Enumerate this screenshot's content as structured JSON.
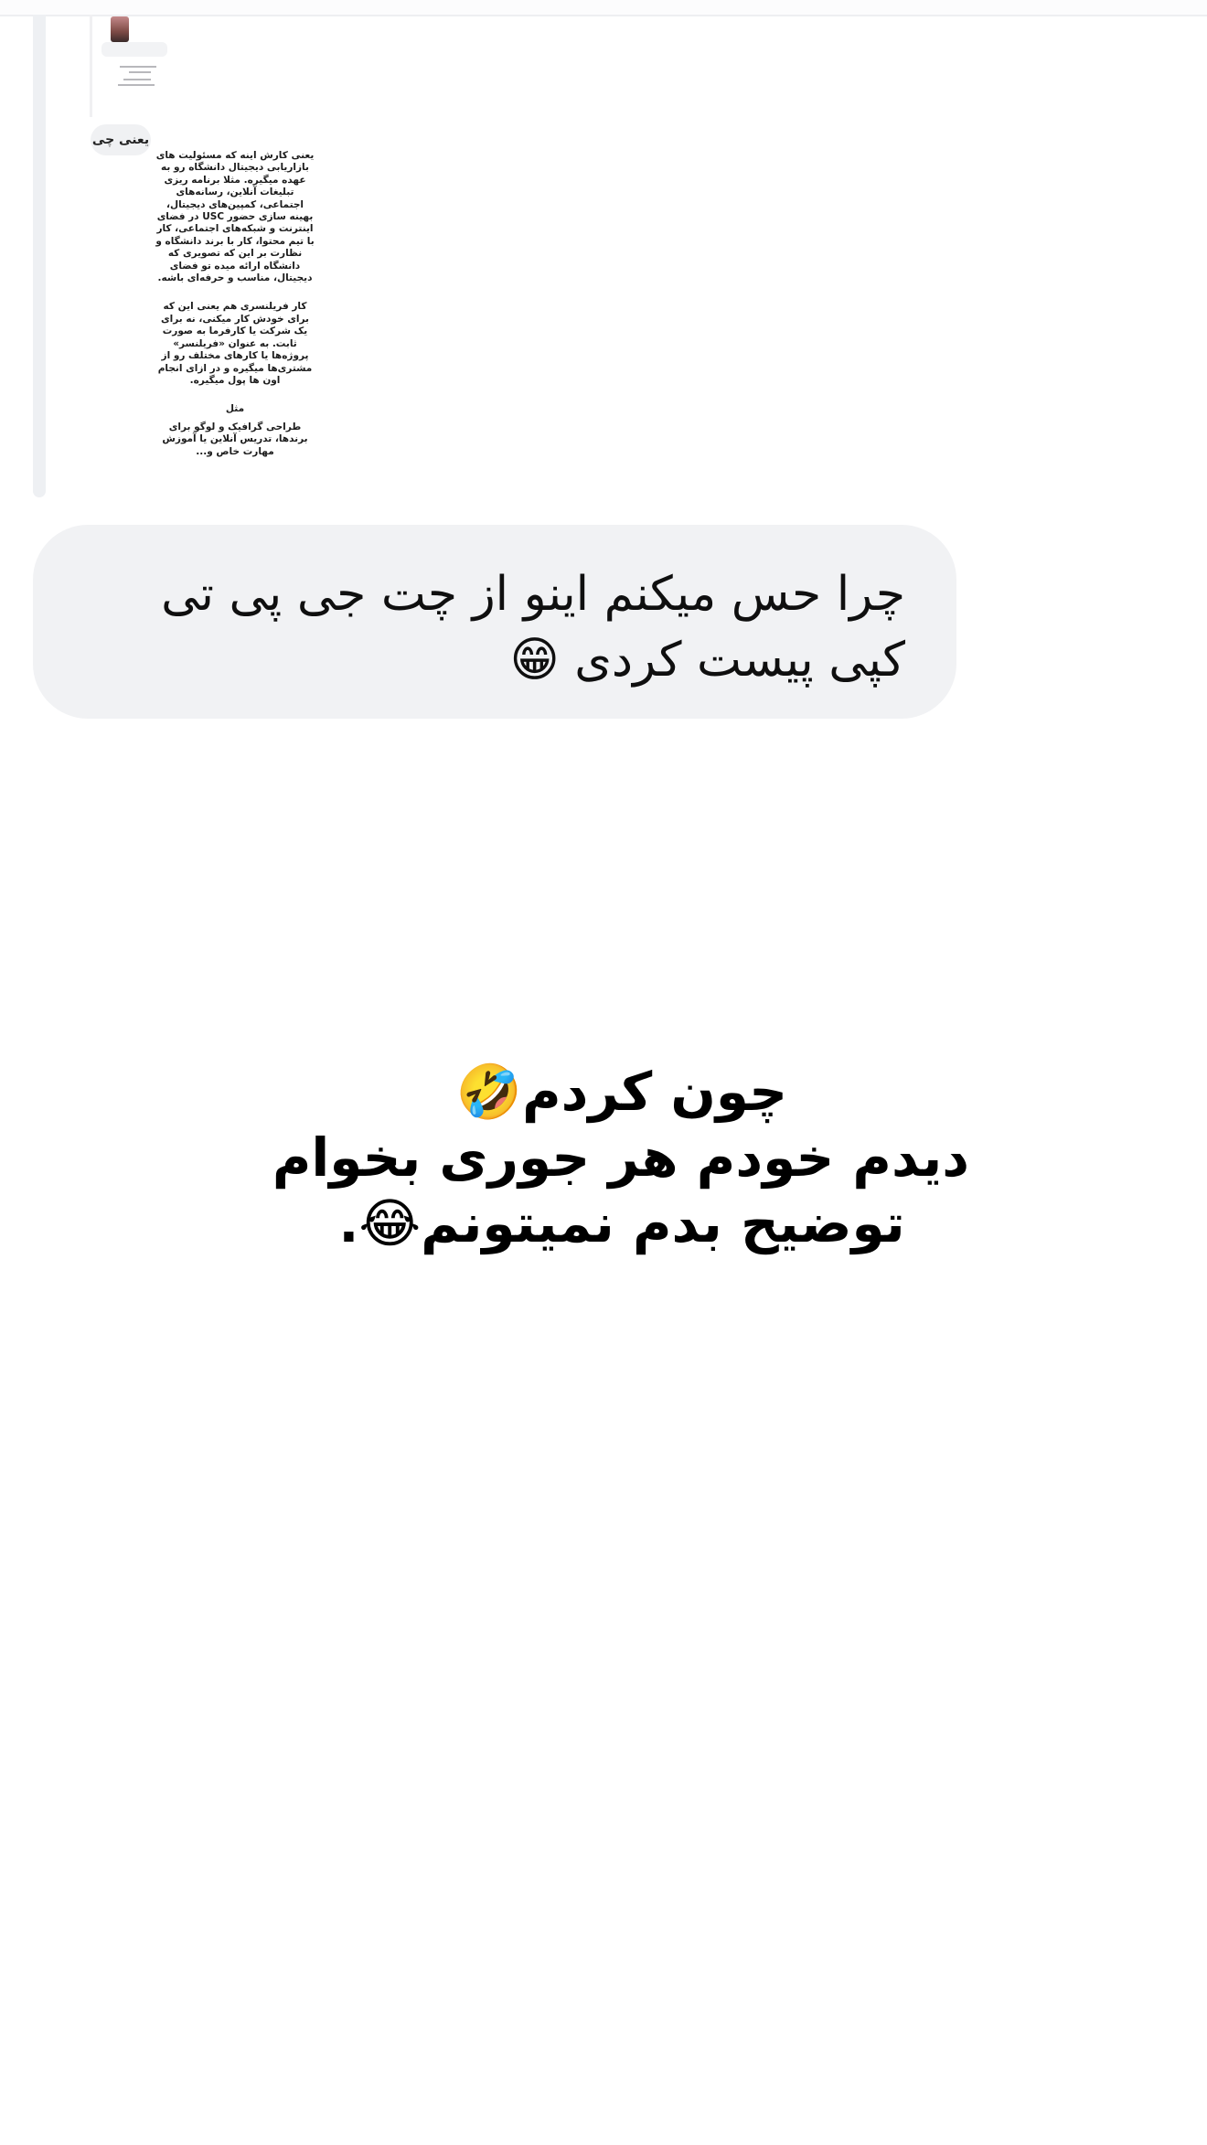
{
  "reply_preview": {
    "thumb_lines": 4
  },
  "small_bubble": {
    "label": "یعنی چی"
  },
  "received_message": {
    "paragraphs": [
      "یعنی کارش اینه که مسئولیت های بازاریابی دیجیتال دانشگاه رو به عهده میگیره. مثلا برنامه ریزی تبلیغات آنلاین، رسانه‌های اجتماعی، کمپین‌های دیجیتال، بهینه سازی حضور USC در فضای اینترنت و شبکه‌های اجتماعی، کار با تیم محتوا، کار با برند دانشگاه و نظارت بر این که تصویری که دانشگاه ارائه میده تو فضای دیجیتال، مناسب و حرفه‌ای باشه.",
      "کار فریلنسری هم یعنی این که برای خودش کار میکنی، نه برای یک شرکت یا کارفرما به صورت ثابت. به عنوان «فریلنسر» پروژه‌ها یا کارهای مختلف رو از مشتری‌ها میگیره و در ازای انجام اون ها پول میگیره.",
      "مثل",
      "طراحی گرافیک و لوگو برای برندها، تدریس آنلاین یا آموزش مهارت خاص و..."
    ]
  },
  "chat_bubble": {
    "text": "چرا حس میکنم اینو از چت جی پی تی کپی پیست کردی 😁"
  },
  "caption": {
    "line1": "چون کردم🤣",
    "line2": "دیدم خودم هر جوری بخوام",
    "line3": "توضیح بدم نمیتونم😂."
  }
}
